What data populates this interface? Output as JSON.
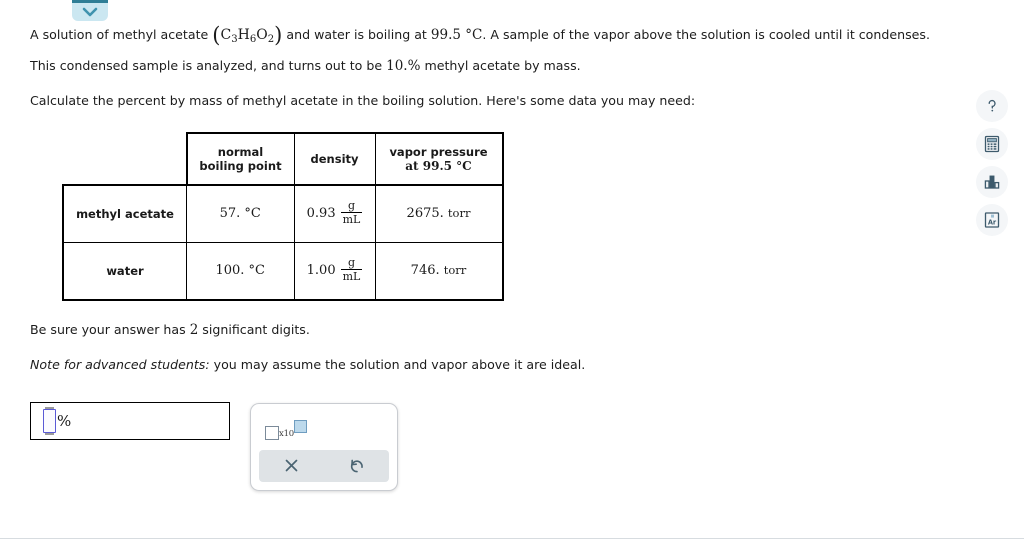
{
  "top_tab": {
    "icon": "chevron-down-icon",
    "accent": "#2f7e96",
    "bg": "#cbe7f1"
  },
  "problem": {
    "line1_a": "A solution of methyl acetate",
    "formula": {
      "open": "(",
      "c": "C",
      "c_sub": "3",
      "h": "H",
      "h_sub": "6",
      "o": "O",
      "o_sub": "2",
      "close": ")"
    },
    "line1_b": "and water is boiling at",
    "temp_boiling": "99.5 °C",
    "line1_c": ". A sample of the vapor above the solution is cooled until it condenses. This condensed sample is analyzed, and turns out to be",
    "vapor_percent": "10.%",
    "line1_d": "methyl acetate by mass.",
    "line2": "Calculate the percent by mass of methyl acetate in the boiling solution. Here's some data you may need:"
  },
  "table": {
    "headers": [
      "",
      "normal boiling point",
      "density",
      "vapor pressure at 99.5 °C"
    ],
    "header_lines": {
      "bp": [
        "normal",
        "boiling point"
      ],
      "density": [
        "density"
      ],
      "vp": [
        "vapor pressure",
        "at 99.5 °C"
      ]
    },
    "rows": [
      {
        "substance": "methyl acetate",
        "boiling_point": "57. °C",
        "density_value": "0.93",
        "density_num": "g",
        "density_den": "mL",
        "vapor_pressure_value": "2675.",
        "vapor_pressure_unit": "torr"
      },
      {
        "substance": "water",
        "boiling_point": "100. °C",
        "density_value": "1.00",
        "density_num": "g",
        "density_den": "mL",
        "vapor_pressure_value": "746.",
        "vapor_pressure_unit": "torr"
      }
    ]
  },
  "sigfig_note": {
    "prefix": "Be sure your answer has",
    "digits": "2",
    "suffix": "significant digits."
  },
  "advanced_note": {
    "label": "Note for advanced students:",
    "text": "you may assume the solution and vapor above it are ideal."
  },
  "answer": {
    "value": "",
    "unit": "%",
    "placeholder": ""
  },
  "palette": {
    "sci_notation": {
      "name": "scientific-notation",
      "label": "x10"
    },
    "clear_label": "×",
    "undo_label": "↺"
  },
  "rail": [
    {
      "name": "help-icon",
      "label": "?"
    },
    {
      "name": "calculator-icon",
      "label": "calculator"
    },
    {
      "name": "bar-chart-icon",
      "label": "chart"
    },
    {
      "name": "periodic-table-icon",
      "label": "Ar"
    }
  ]
}
